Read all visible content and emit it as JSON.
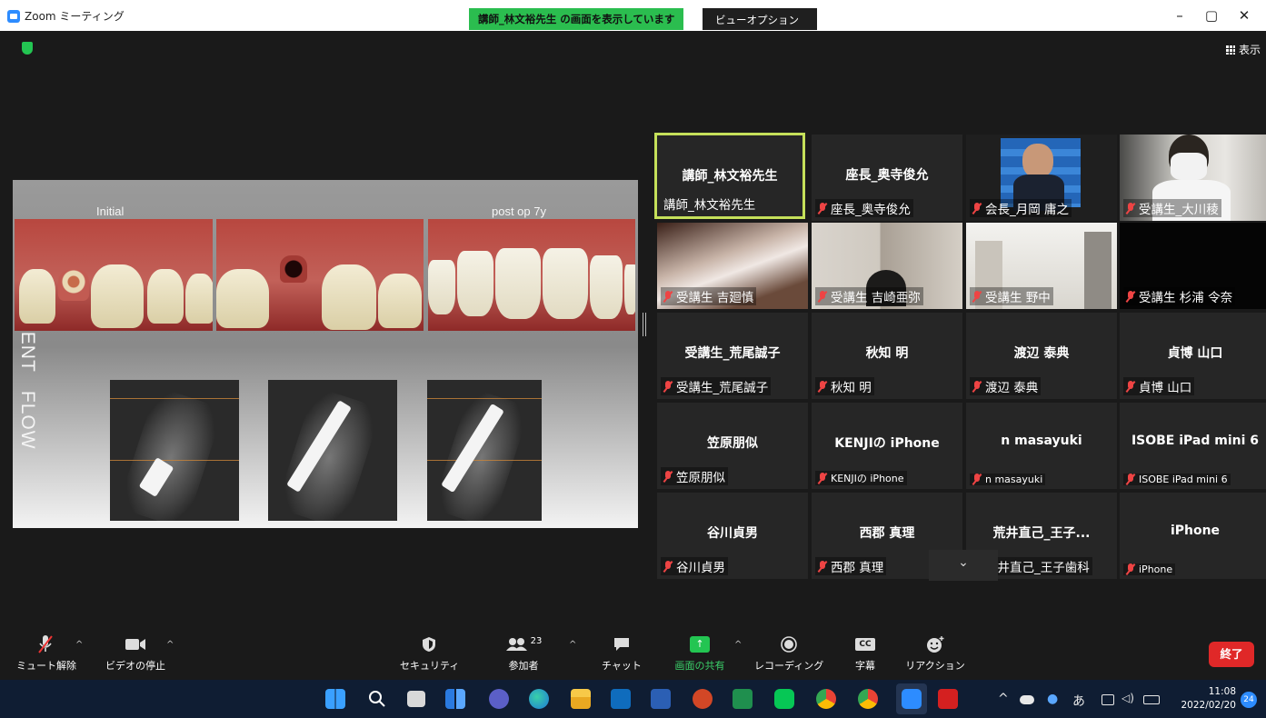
{
  "titlebar": {
    "app_title": "Zoom ミーティング",
    "share_banner": "講師_林文裕先生 の画面を表示しています",
    "view_options": "ビューオプション ⌄",
    "minimize": "–",
    "maximize": "▢",
    "close": "✕"
  },
  "meeting": {
    "view_label": "表示"
  },
  "slide": {
    "vertical_title": "TREATMENT   FLOW",
    "label_left": "Initial",
    "label_right": "post op 7y"
  },
  "participants": [
    {
      "center": "講師_林文裕先生",
      "name": "講師_林文裕先生",
      "muted": false,
      "active": true,
      "video": false
    },
    {
      "center": "座長_奥寺俊允",
      "name": "座長_奥寺俊允",
      "muted": true,
      "active": false,
      "video": false
    },
    {
      "center": "",
      "name": "会長_月岡 庸之",
      "muted": true,
      "active": false,
      "video": true
    },
    {
      "center": "",
      "name": "受講生_大川稜",
      "muted": true,
      "active": false,
      "video": true
    },
    {
      "center": "",
      "name": "受講生 吉廻慎",
      "muted": true,
      "active": false,
      "video": true
    },
    {
      "center": "",
      "name": "受講生 吉崎亜弥",
      "muted": true,
      "active": false,
      "video": true
    },
    {
      "center": "",
      "name": "受講生 野中",
      "muted": true,
      "active": false,
      "video": true
    },
    {
      "center": "",
      "name": "受講生 杉浦 令奈",
      "muted": true,
      "active": false,
      "video": true
    },
    {
      "center": "受講生_荒尾誠子",
      "name": "受講生_荒尾誠子",
      "muted": true,
      "active": false,
      "video": false
    },
    {
      "center": "秋知 明",
      "name": "秋知 明",
      "muted": true,
      "active": false,
      "video": false
    },
    {
      "center": "渡辺 泰典",
      "name": "渡辺 泰典",
      "muted": true,
      "active": false,
      "video": false
    },
    {
      "center": "貞博 山口",
      "name": "貞博 山口",
      "muted": true,
      "active": false,
      "video": false
    },
    {
      "center": "笠原朋似",
      "name": "笠原朋似",
      "muted": true,
      "active": false,
      "video": false
    },
    {
      "center": "KENJIの iPhone",
      "name": "KENJIの iPhone",
      "muted": true,
      "active": false,
      "video": false
    },
    {
      "center": "n masayuki",
      "name": "n masayuki",
      "muted": true,
      "active": false,
      "video": false
    },
    {
      "center": "ISOBE iPad mini 6",
      "name": "ISOBE iPad mini 6",
      "muted": true,
      "active": false,
      "video": false
    },
    {
      "center": "谷川貞男",
      "name": "谷川貞男",
      "muted": true,
      "active": false,
      "video": false
    },
    {
      "center": "西郡 真理",
      "name": "西郡 真理",
      "muted": true,
      "active": false,
      "video": false
    },
    {
      "center": "荒井直己_王子...",
      "name": "荒井直己_王子歯科",
      "muted": true,
      "active": false,
      "video": false
    },
    {
      "center": "iPhone",
      "name": "iPhone",
      "muted": true,
      "active": false,
      "video": false
    }
  ],
  "toolbar": {
    "unmute": "ミュート解除",
    "stop_video": "ビデオの停止",
    "security": "セキュリティ",
    "participants": "参加者",
    "participants_count": "23",
    "chat": "チャット",
    "share_screen": "画面の共有",
    "record": "レコーディング",
    "captions": "字幕",
    "captions_icon": "CC",
    "reactions": "リアクション",
    "end": "終了"
  },
  "taskbar": {
    "ime": "あ",
    "time": "11:08",
    "date": "2022/02/20",
    "notifications": "24"
  },
  "colors": {
    "share_green": "#2bbd4f",
    "active_speaker": "#c5e05a",
    "end_red": "#e02828",
    "zoom_blue": "#2d8cff"
  }
}
